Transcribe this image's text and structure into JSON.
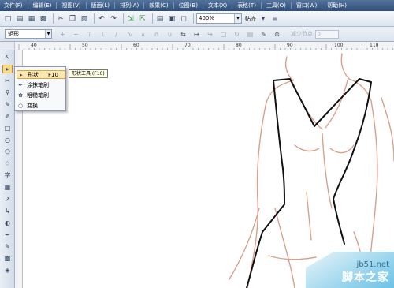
{
  "menu": {
    "items": [
      "文件(F)",
      "编辑(E)",
      "视图(V)",
      "版面(L)",
      "排列(A)",
      "效果(C)",
      "位图(B)",
      "文本(X)",
      "表格(T)",
      "工具(O)",
      "窗口(W)",
      "帮助(H)"
    ]
  },
  "toolbar": {
    "icons": [
      "new-icon",
      "open-icon",
      "save-icon",
      "print-icon",
      "cut-icon",
      "copy-icon",
      "paste-icon",
      "undo-icon",
      "redo-icon",
      "import-icon",
      "export-icon",
      "app-launcher-icon",
      "welcome-icon",
      "full-screen-icon"
    ],
    "zoom_value": "400%",
    "snap_label": "贴齐"
  },
  "propbar": {
    "shape_select": "矩形",
    "reduce_nodes_label": "减少节点",
    "reduce_nodes_value": "0"
  },
  "ruler": {
    "ticks": [
      "40",
      "50",
      "60",
      "70",
      "80",
      "90",
      "100",
      "110"
    ]
  },
  "toolbox": {
    "text_tool_label": "字"
  },
  "flyout": {
    "items": [
      {
        "label": "形状",
        "shortcut": "F10"
      },
      {
        "label": "涂抹笔刷",
        "shortcut": ""
      },
      {
        "label": "粗糙笔刷",
        "shortcut": ""
      },
      {
        "label": "变换",
        "shortcut": ""
      }
    ],
    "tooltip": "形状工具 (F10)"
  },
  "watermark": {
    "site": "jb51.net",
    "name": "脚本之家"
  },
  "colors": {
    "menubar": "#3d5c86",
    "sketch_line": "#d9a08e",
    "path_line": "#111111",
    "watermark_blue": "#6cc1e5"
  }
}
